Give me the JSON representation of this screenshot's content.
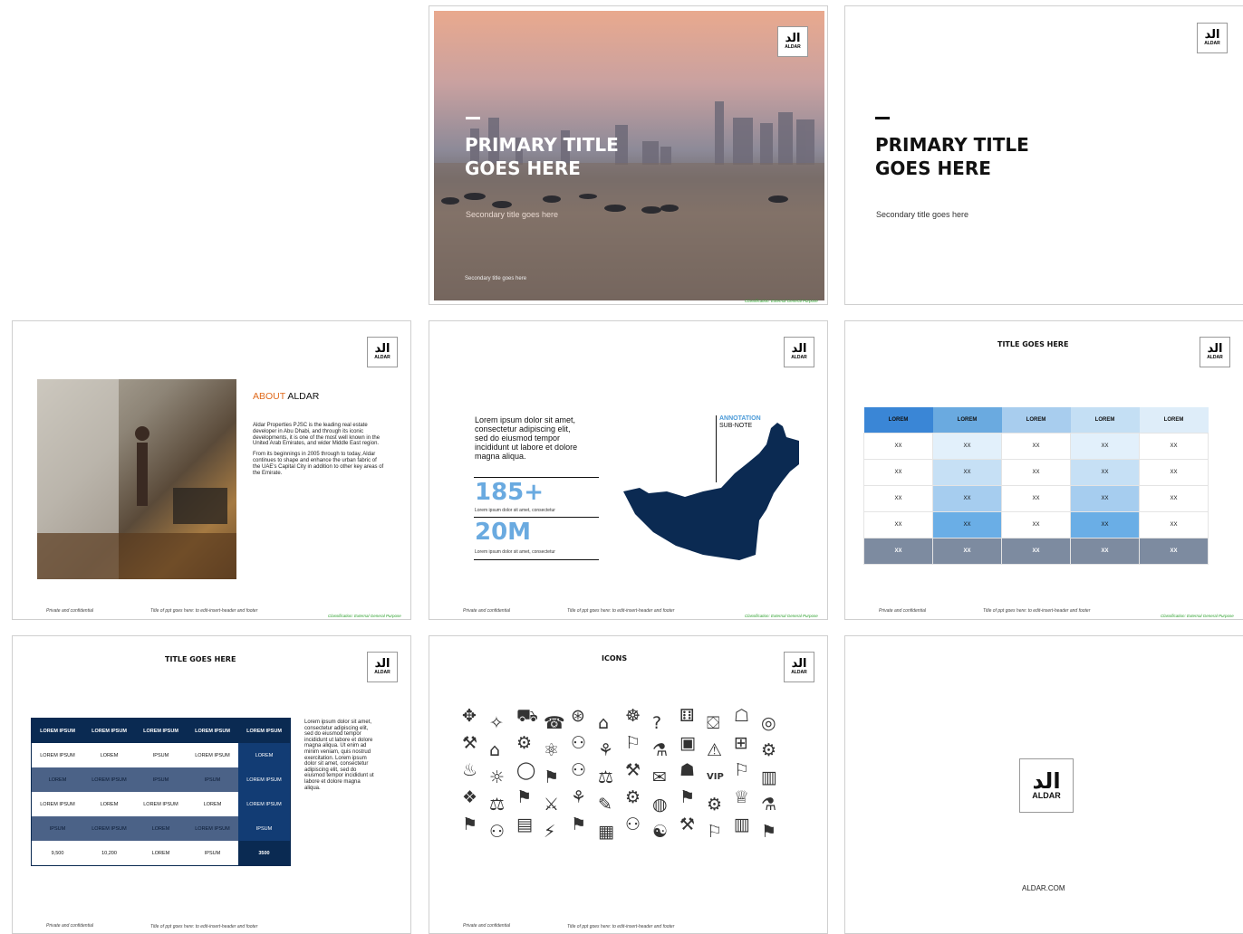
{
  "logo": {
    "mark": "ﺍﻟﺪ",
    "word": "ALDAR"
  },
  "footer": {
    "private": "Private and confidential",
    "title_note": "Title of ppt goes here: to edit-insert-header and footer",
    "classification": "Classification: External General Purpose"
  },
  "slide2": {
    "title": "PRIMARY TITLE GOES HERE",
    "subtitle": "Secondary title goes here",
    "small": "Secondary title goes here"
  },
  "slide3": {
    "title": "PRIMARY TITLE GOES HERE",
    "subtitle": "Secondary title goes here"
  },
  "slide4": {
    "about_prefix": "ABOUT",
    "about_name": "ALDAR",
    "para1": "Aldar Properties PJSC is the leading real estate developer in Abu Dhabi, and through its iconic developments, it is one of the most well known in the United Arab Emirates, and wider Middle East region.",
    "para2": "From its beginnings in 2005 through to today, Aldar continues to shape and enhance the urban fabric of the UAE's Capital City in addition to other key areas of the Emirate."
  },
  "slide5": {
    "lorem": "Lorem ipsum dolor sit amet, consectetur adipiscing elit, sed do eiusmod tempor incididunt ut labore et dolore magna aliqua.",
    "stat1": "185+",
    "stat1_caption": "Lorem ipsum dolor sit amet, consectetur",
    "stat2": "20M",
    "stat2_caption": "Lorem ipsum dolor sit amet, consectetur",
    "annotation": "ANNOTATION",
    "subnote": "SUB-NOTE",
    "colors": {
      "map": "#0b2a52",
      "stat": "#6aaae0"
    }
  },
  "slide6": {
    "title": "TITLE GOES HERE",
    "headers": [
      "LOREM",
      "LOREM",
      "LOREM",
      "LOREM",
      "LOREM"
    ],
    "rows": [
      [
        "XX",
        "XX",
        "XX",
        "XX",
        "XX"
      ],
      [
        "XX",
        "XX",
        "XX",
        "XX",
        "XX"
      ],
      [
        "XX",
        "XX",
        "XX",
        "XX",
        "XX"
      ],
      [
        "XX",
        "XX",
        "XX",
        "XX",
        "XX"
      ]
    ],
    "total": [
      "XX",
      "XX",
      "XX",
      "XX",
      "XX"
    ]
  },
  "slide7": {
    "title": "TITLE GOES HERE",
    "headers": [
      "LOREM IPSUM",
      "LOREM IPSUM",
      "LOREM IPSUM",
      "LOREM IPSUM",
      "LOREM IPSUM"
    ],
    "rows": [
      [
        "LOREM IPSUM",
        "LOREM",
        "IPSUM",
        "LOREM IPSUM",
        "LOREM"
      ],
      [
        "LOREM",
        "LOREM IPSUM",
        "IPSUM",
        "IPSUM",
        "LOREM IPSUM"
      ],
      [
        "LOREM IPSUM",
        "LOREM",
        "LOREM IPSUM",
        "LOREM",
        "LOREM IPSUM"
      ],
      [
        "IPSUM",
        "LOREM IPSUM",
        "LOREM",
        "LOREM IPSUM",
        "IPSUM"
      ],
      [
        "9,500",
        "10,200",
        "LOREM",
        "IPSUM",
        "3500"
      ]
    ],
    "side": "Lorem ipsum dolor sit amet, consectetur adipiscing elit, sed do eiusmod tempor incididunt ut labore et dolore magna aliqua. Ut enim ad minim veniam, quis nostrud exercitation. Lorem ipsum dolor sit amet, consectetur adipiscing elit, sed do eiusmod tempor incididunt ut labore et dolore magna aliqua."
  },
  "slide8": {
    "title": "ICONS",
    "icons": [
      "✥",
      "✧",
      "⛟",
      "☎",
      "⊛",
      "⌂",
      "☸",
      "?",
      "⚅",
      "⛋",
      "☖",
      "◎",
      "⚒",
      "⌂",
      "⚙",
      "⚛",
      "⚇",
      "⚘",
      "⚐",
      "⚗",
      "▣",
      "⚠",
      "⊞",
      "⚙",
      "♨",
      "☼",
      "◯",
      "⚑",
      "⚇",
      "⚖",
      "⚒",
      "✉",
      "☗",
      "VIP",
      "⚐",
      "▥",
      "❖",
      "⚖",
      "⚑",
      "⚔",
      "⚘",
      "✎",
      "⚙",
      "◍",
      "⚑",
      "⚙",
      "♕",
      "⚗",
      "⚑",
      "⚇",
      "▤",
      "⚡",
      "⚑",
      "▦",
      "⚇",
      "☯",
      "⚒",
      "⚐",
      "▥",
      "⚑"
    ]
  },
  "slide9": {
    "url": "ALDAR.COM"
  }
}
